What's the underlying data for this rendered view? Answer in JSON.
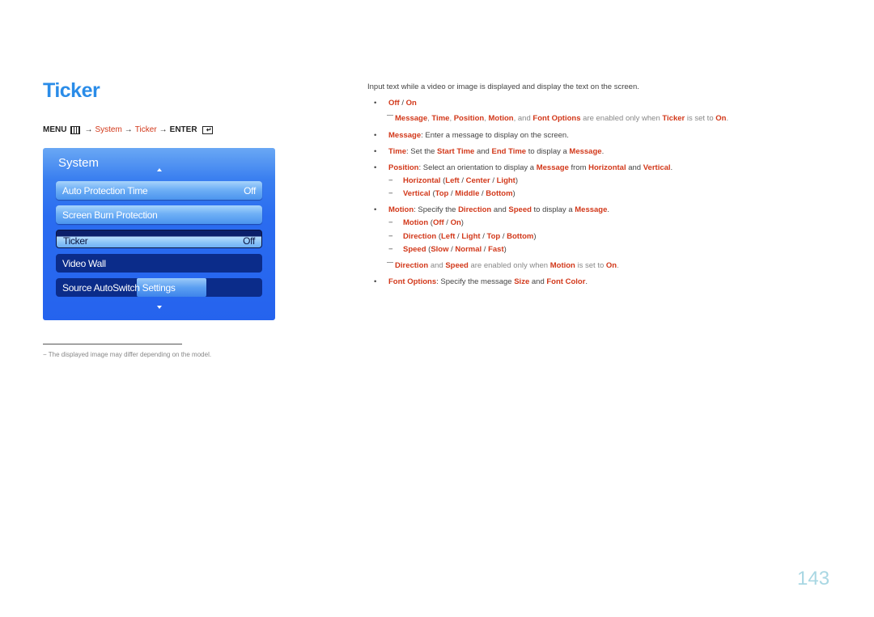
{
  "page": {
    "title": "Ticker",
    "page_number": "143"
  },
  "breadcrumb": {
    "menu": "MENU",
    "menu_icon": "menu-grid-icon",
    "arrow": "→",
    "system": "System",
    "ticker": "Ticker",
    "enter": "ENTER",
    "enter_icon": "enter-return-icon"
  },
  "osd": {
    "title": "System",
    "up_icon": "triangle-up-icon",
    "down_icon": "triangle-down-icon",
    "items": [
      {
        "label": "Auto Protection Time",
        "value": "Off"
      },
      {
        "label": "Screen Burn Protection",
        "value": ""
      },
      {
        "label": "Ticker",
        "value": "Off"
      },
      {
        "label": "Video Wall",
        "value": ""
      },
      {
        "label": "Source AutoSwitch Settings",
        "value": ""
      }
    ]
  },
  "footnote": "The displayed image may differ depending on the model.",
  "content": {
    "intro": "Input text while a video or image is displayed and display the text on the screen.",
    "bullet": "•",
    "dash": "−",
    "off_on": {
      "off": "Off",
      "sep": " / ",
      "on": "On"
    },
    "note1": {
      "t1": "Message",
      "s1": ", ",
      "t2": "Time",
      "s2": ", ",
      "t3": "Position",
      "s3": ", ",
      "t4": "Motion",
      "s4": ", and ",
      "t5": "Font Options",
      "s5": " are enabled only when ",
      "t6": "Ticker",
      "s6": " is set to ",
      "t7": "On",
      "s7": "."
    },
    "message": {
      "t1": "Message",
      "s1": ": Enter a message to display on the screen."
    },
    "time": {
      "t1": "Time",
      "s1": ": Set the ",
      "t2": "Start Time",
      "s2": " and ",
      "t3": "End Time",
      "s3": " to display a ",
      "t4": "Message",
      "s4": "."
    },
    "position": {
      "t1": "Position",
      "s1": ": Select an orientation to display a ",
      "t2": "Message",
      "s2": " from ",
      "t3": "Horizontal",
      "s3": " and ",
      "t4": "Vertical",
      "s4": "."
    },
    "horizontal": {
      "t1": "Horizontal",
      "s1": " (",
      "t2": "Left",
      "s2": " / ",
      "t3": "Center",
      "s3": " / ",
      "t4": "Light",
      "s4": ")"
    },
    "vertical": {
      "t1": "Vertical",
      "s1": " (",
      "t2": "Top",
      "s2": " / ",
      "t3": "Middle",
      "s3": " / ",
      "t4": "Bottom",
      "s4": ")"
    },
    "motion": {
      "t1": "Motion",
      "s1": ": Specify the ",
      "t2": "Direction",
      "s2": " and ",
      "t3": "Speed",
      "s3": " to display a ",
      "t4": "Message",
      "s4": "."
    },
    "motion_sub": {
      "t1": "Motion",
      "s1": " (",
      "t2": "Off",
      "s2": " / ",
      "t3": "On",
      "s3": ")"
    },
    "direction_sub": {
      "t1": "Direction",
      "s1": " (",
      "t2": "Left",
      "s2": " / ",
      "t3": "Light",
      "s3": " / ",
      "t4": "Top",
      "s4": " / ",
      "t5": "Bottom",
      "s5": ")"
    },
    "speed_sub": {
      "t1": "Speed",
      "s1": " (",
      "t2": "Slow",
      "s2": " / ",
      "t3": "Normal",
      "s3": " / ",
      "t4": "Fast",
      "s4": ")"
    },
    "note2": {
      "t1": "Direction",
      "s1": " and ",
      "t2": "Speed",
      "s2": " are enabled only when ",
      "t3": "Motion",
      "s3": " is set to ",
      "t4": "On",
      "s4": "."
    },
    "font_options": {
      "t1": "Font Options",
      "s1": ": Specify the message ",
      "t2": "Size",
      "s2": " and ",
      "t3": "Font Color",
      "s3": "."
    }
  }
}
